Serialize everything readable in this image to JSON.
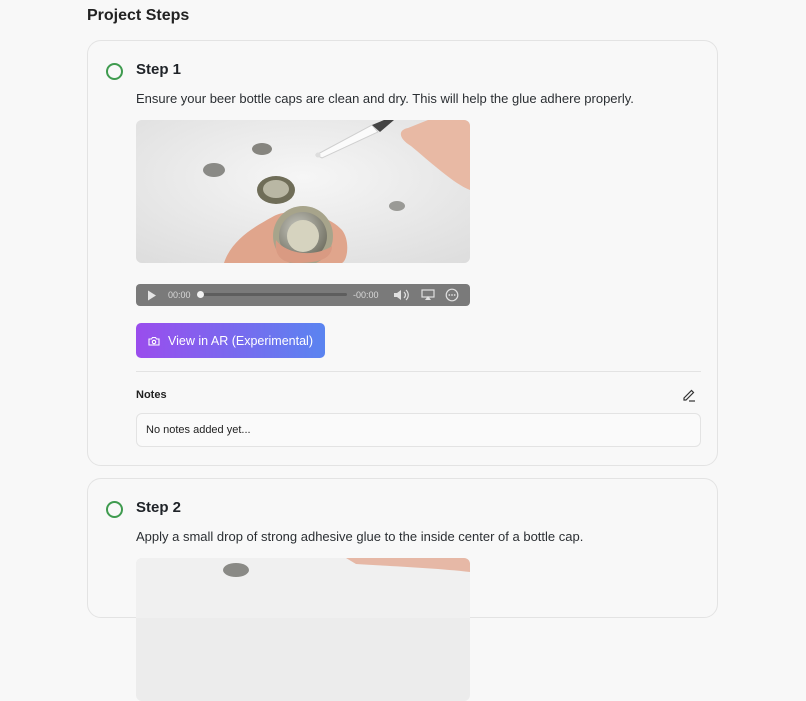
{
  "page": {
    "title": "Project Steps"
  },
  "steps": [
    {
      "title": "Step 1",
      "description": "Ensure your beer bottle caps are clean and dry. This will help the glue adhere properly.",
      "audio": {
        "current_time": "00:00",
        "remaining_time": "-00:00"
      },
      "ar_button_label": "View in AR (Experimental)",
      "notes_label": "Notes",
      "notes_text": "No notes added yet..."
    },
    {
      "title": "Step 2",
      "description": "Apply a small drop of strong adhesive glue to the inside center of a bottle cap."
    }
  ],
  "colors": {
    "check_ring": "#3f9b4f",
    "ar_gradient_start": "#9a4ded",
    "ar_gradient_end": "#5a84f0"
  },
  "icons": {
    "play": "play-icon",
    "volume": "volume-icon",
    "airplay": "airplay-icon",
    "more": "more-options-icon",
    "camera": "camera-icon",
    "edit": "edit-icon",
    "check": "check-circle-icon"
  }
}
